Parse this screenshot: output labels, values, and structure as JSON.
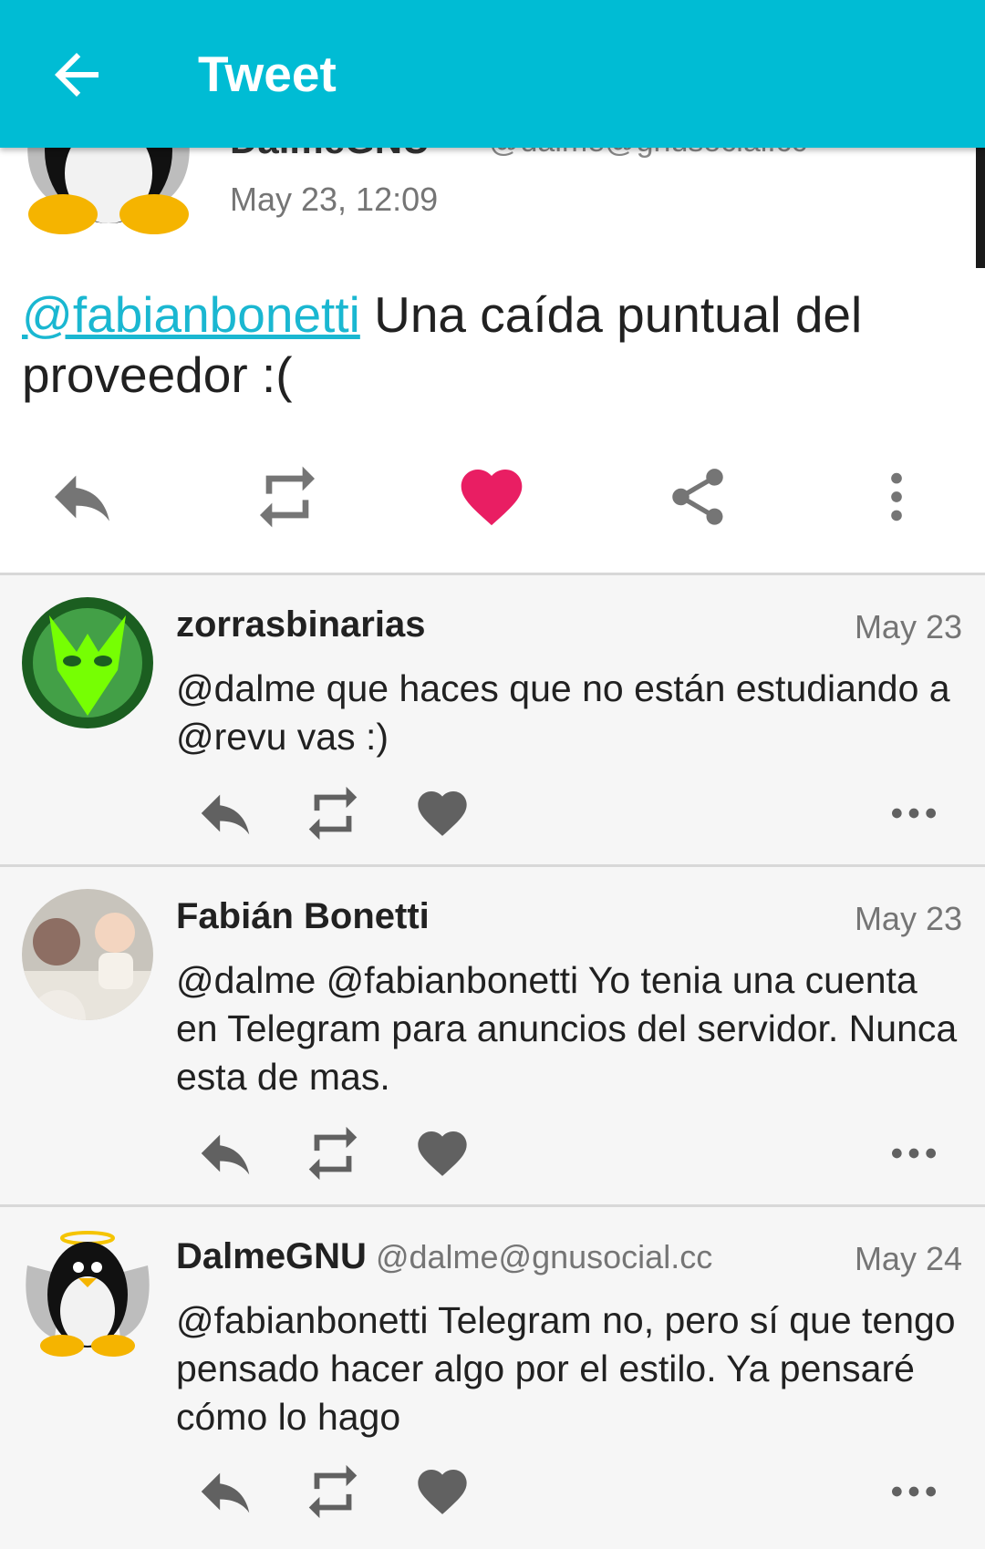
{
  "appbar": {
    "title": "Tweet"
  },
  "main_tweet": {
    "display_name": "DalmeGNU",
    "handle": "@dalme@gnusocial.cc",
    "date": "May 23, 12:09",
    "mention": "@fabianbonetti",
    "text": " Una caída puntual del proveedor :(",
    "liked": true,
    "like_color": "#e91e63"
  },
  "replies": [
    {
      "name": "zorrasbinarias",
      "handle": "",
      "date": "May 23",
      "text": "@dalme que haces que no están estudiando a @revu vas :)"
    },
    {
      "name": "Fabián Bonetti",
      "handle": "",
      "date": "May 23",
      "text": "@dalme @fabianbonetti Yo tenia una cuenta en Telegram para anuncios del servidor. Nunca esta de mas."
    },
    {
      "name": "DalmeGNU",
      "handle": "@dalme@gnusocial.cc",
      "date": "May 24",
      "text": "@fabianbonetti Telegram no, pero sí que tengo pensado hacer algo por el estilo. Ya pensaré cómo lo hago"
    }
  ],
  "colors": {
    "accent": "#00bcd4",
    "link": "#1ab7d1",
    "like": "#e91e63",
    "icon": "#757575"
  }
}
